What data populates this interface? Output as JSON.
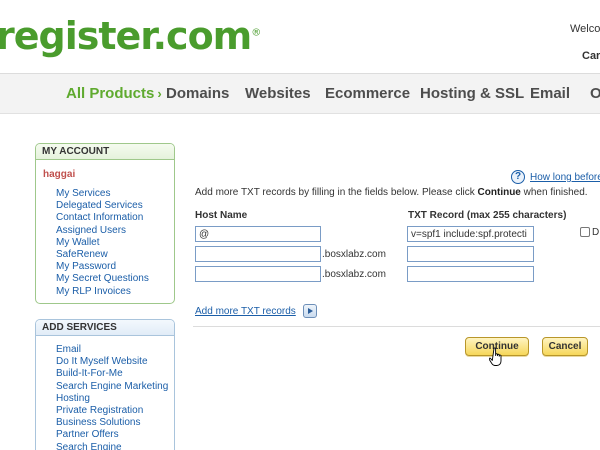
{
  "header": {
    "logo_text": "register.com",
    "logo_mark": "®",
    "welcome_text": "Welco",
    "cart_text": "Car"
  },
  "nav": {
    "items": [
      {
        "label": "All Products",
        "active": true
      },
      {
        "label": "Domains"
      },
      {
        "label": "Websites"
      },
      {
        "label": "Ecommerce"
      },
      {
        "label": "Hosting & SSL"
      },
      {
        "label": "Email"
      },
      {
        "label": "O"
      }
    ],
    "chevron": "›"
  },
  "sidebar": {
    "my_account": {
      "title": "MY ACCOUNT",
      "username": "haggai",
      "links": [
        "My Services",
        "Delegated Services",
        "Contact Information",
        "Assigned Users",
        "My Wallet",
        "SafeRenew",
        "My Password",
        "My Secret Questions",
        "My RLP Invoices"
      ]
    },
    "add_services": {
      "title": "ADD SERVICES",
      "links": [
        "Email",
        "Do It Myself Website",
        "Build-It-For-Me",
        "Search Engine Marketing",
        "Hosting",
        "Private Registration",
        "Business Solutions",
        "Partner Offers",
        "Search Engine"
      ]
    }
  },
  "main": {
    "help_icon": "?",
    "help_link": "How long before",
    "instructions_before": "Add more TXT records by filling in the fields below. Please click ",
    "instructions_bold": "Continue",
    "instructions_after": " when finished.",
    "host_name_header": "Host Name",
    "txt_record_header": "TXT Record (max 255 characters)",
    "rows": [
      {
        "host": "@",
        "suffix": "",
        "txt": "v=spf1 include:spf.protecti"
      },
      {
        "host": "",
        "suffix": ".bosxlabz.com",
        "txt": ""
      },
      {
        "host": "",
        "suffix": ".bosxlabz.com",
        "txt": ""
      }
    ],
    "delete_label": "D",
    "add_more_link": "Add more TXT records",
    "continue_label": "Continue",
    "cancel_label": "Cancel"
  },
  "colors": {
    "brand_green": "#4a9c2d",
    "link_blue": "#1b5ea8",
    "button_yellow": "#f6d75a"
  },
  "icons": {
    "help": "help-icon",
    "add_more": "arrow-right-icon",
    "cursor": "hand-pointer-icon"
  }
}
